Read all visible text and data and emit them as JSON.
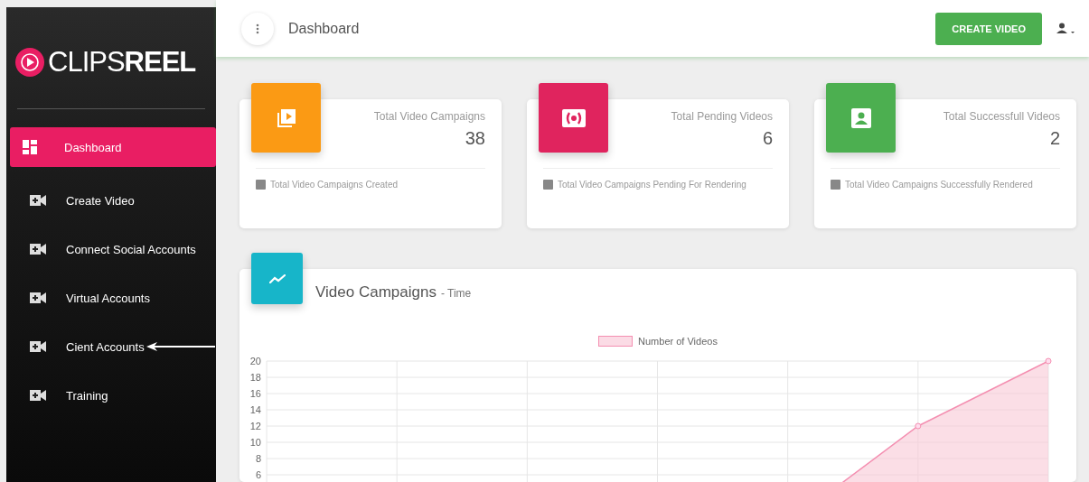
{
  "sidebar": {
    "logo": "CLIPS**REEL**",
    "items": [
      {
        "label": "Dashboard",
        "kind": "dashboard",
        "selected": true,
        "pointed": false
      },
      {
        "label": "Create Video",
        "kind": "video",
        "selected": false,
        "pointed": false
      },
      {
        "label": "Connect Social Accounts",
        "kind": "video",
        "selected": false,
        "pointed": false
      },
      {
        "label": "Virtual Accounts",
        "kind": "video",
        "selected": false,
        "pointed": false
      },
      {
        "label": "Cient Accounts",
        "kind": "video",
        "selected": false,
        "pointed": true
      },
      {
        "label": "Training",
        "kind": "video",
        "selected": false,
        "pointed": false
      }
    ]
  },
  "header": {
    "title": "Dashboard",
    "button": "CREATE VIDEO"
  },
  "cards": [
    {
      "kind": "campaigns",
      "color": "#fb9a14",
      "title": "Total Video Campaigns",
      "value": "38",
      "footer": "Total Video Campaigns Created"
    },
    {
      "kind": "pending",
      "color": "#e0245e",
      "title": "Total Pending Videos",
      "value": "6",
      "footer": "Total Video Campaigns Pending For Rendering"
    },
    {
      "kind": "success",
      "color": "#4caf50",
      "title": "Total Successfull Videos",
      "value": "2",
      "footer": "Total Video Campaigns Successfully Rendered"
    }
  ],
  "chart_panel": {
    "title": "Video Campaigns",
    "subtitle": "- Time",
    "chart_data": {
      "type": "area",
      "grid": true,
      "series": [
        {
          "name": "Number of Videos",
          "color": "#f48fb1",
          "values": [
            0,
            0,
            0,
            0,
            0,
            12,
            20
          ]
        }
      ],
      "ylim": [
        0,
        20
      ],
      "yticks": [
        6,
        8,
        10,
        12,
        14,
        16,
        18,
        20
      ]
    }
  }
}
